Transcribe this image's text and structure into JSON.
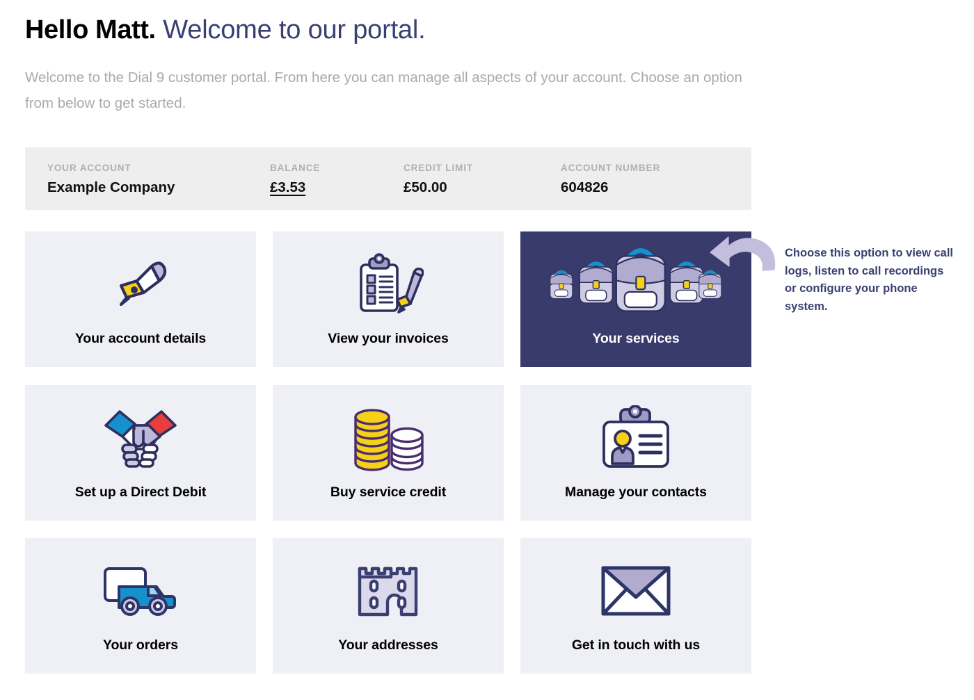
{
  "header": {
    "greeting": "Hello Matt.",
    "welcome": "Welcome to our portal.",
    "subtext": "Welcome to the Dial 9 customer portal. From here you can manage all aspects of your account. Choose an option from below to get started."
  },
  "account_bar": {
    "columns": [
      {
        "label": "YOUR ACCOUNT",
        "value": "Example Company",
        "underlined": false
      },
      {
        "label": "BALANCE",
        "value": "£3.53",
        "underlined": true
      },
      {
        "label": "CREDIT LIMIT",
        "value": "£50.00",
        "underlined": false
      },
      {
        "label": "ACCOUNT NUMBER",
        "value": "604826",
        "underlined": false
      }
    ]
  },
  "cards": [
    {
      "label": "Your account details",
      "icon": "fountain-pen-icon",
      "active": false
    },
    {
      "label": "View your invoices",
      "icon": "clipboard-pen-icon",
      "active": false
    },
    {
      "label": "Your services",
      "icon": "backpacks-icon",
      "active": true
    },
    {
      "label": "Set up a Direct Debit",
      "icon": "handshake-icon",
      "active": false
    },
    {
      "label": "Buy service credit",
      "icon": "coin-stacks-icon",
      "active": false
    },
    {
      "label": "Manage your contacts",
      "icon": "id-badge-icon",
      "active": false
    },
    {
      "label": "Your orders",
      "icon": "delivery-truck-icon",
      "active": false
    },
    {
      "label": "Your addresses",
      "icon": "castle-icon",
      "active": false
    },
    {
      "label": "Get in touch with us",
      "icon": "envelope-icon",
      "active": false
    }
  ],
  "annotation": {
    "text": "Choose this option to view call logs, listen to call recordings or configure your phone system.",
    "arrow_icon": "curved-arrow-icon"
  },
  "colors": {
    "navy": "#383b6b",
    "card_bg": "#eff0f6",
    "account_bar_bg": "#eeeeee",
    "heading_accent": "#3a3f72",
    "subtext": "#aaaaaa",
    "lavender": "#bdb8d8",
    "yellow": "#f7d117",
    "blue": "#1791cd",
    "red": "#ea3d3d"
  }
}
